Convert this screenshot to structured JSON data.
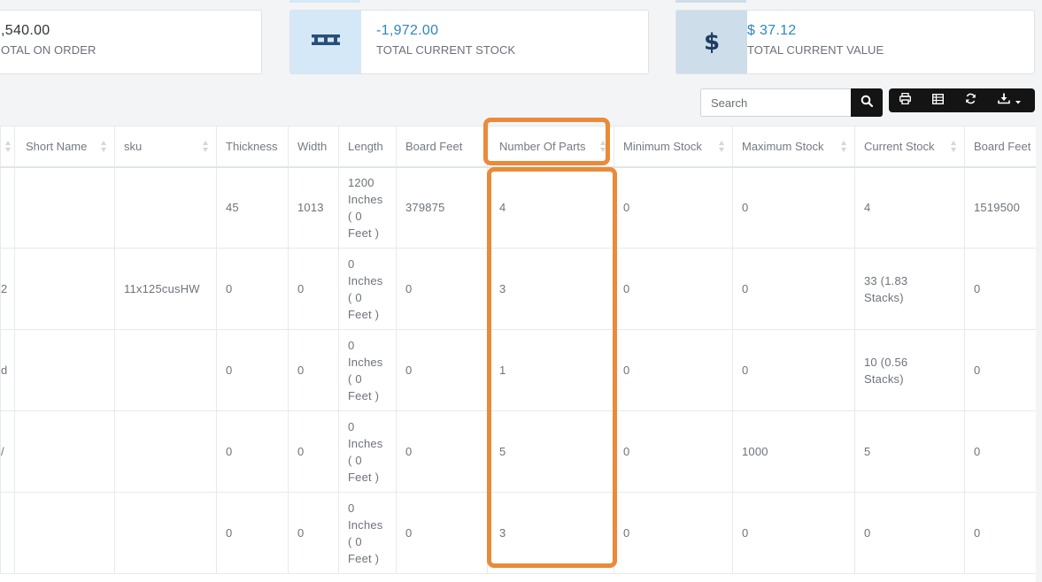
{
  "stats": {
    "on_order": {
      "value": ",540.00",
      "label": "OTAL ON ORDER"
    },
    "current_stock": {
      "value": "-1,972.00",
      "label": "TOTAL CURRENT STOCK",
      "icon": "pallet-icon"
    },
    "current_value": {
      "value": "$ 37.12",
      "label": "TOTAL CURRENT VALUE",
      "icon": "dollar-icon",
      "icon_glyph": "$"
    }
  },
  "colors": {
    "accent_blue": "#2e86c1",
    "icon_bg_blue": "#d4e8f7",
    "icon_bg_gray": "#cddde9",
    "highlight": "#ea8a3a",
    "toolbar_dark": "#141414"
  },
  "toolbar": {
    "search_placeholder": "Search",
    "buttons": [
      "search-icon",
      "print-icon",
      "columns-icon",
      "refresh-icon",
      "download-icon"
    ]
  },
  "table": {
    "headers": [
      "",
      "Short Name",
      "sku",
      "Thickness",
      "Width",
      "Length",
      "Board Feet",
      "Number Of Parts",
      "Minimum Stock",
      "Maximum Stock",
      "Current Stock",
      "Board Feet"
    ],
    "rows": [
      {
        "first": "",
        "short_name": "",
        "sku": "",
        "thickness": "45",
        "width": "1013",
        "length": [
          "1200",
          "Inches",
          "( 0",
          "Feet )"
        ],
        "board_feet": "379875",
        "parts": "4",
        "min": "0",
        "max": "0",
        "current": "4",
        "board_feet2": "1519500"
      },
      {
        "first": "2",
        "short_name": "",
        "sku": "11x125cusHW",
        "thickness": "0",
        "width": "0",
        "length": [
          "0",
          "Inches",
          "( 0",
          "Feet )"
        ],
        "board_feet": "0",
        "parts": "3",
        "min": "0",
        "max": "0",
        "current": "33 (1.83 Stacks)",
        "board_feet2": "0"
      },
      {
        "first": "d",
        "short_name": "",
        "sku": "",
        "thickness": "0",
        "width": "0",
        "length": [
          "0",
          "Inches",
          "( 0",
          "Feet )"
        ],
        "board_feet": "0",
        "parts": "1",
        "min": "0",
        "max": "0",
        "current": "10 (0.56 Stacks)",
        "board_feet2": "0"
      },
      {
        "first": "/",
        "short_name": "",
        "sku": "",
        "thickness": "0",
        "width": "0",
        "length": [
          "0",
          "Inches",
          "( 0",
          "Feet )"
        ],
        "board_feet": "0",
        "parts": "5",
        "min": "0",
        "max": "1000",
        "current": "5",
        "board_feet2": "0"
      },
      {
        "first": "",
        "short_name": "",
        "sku": "",
        "thickness": "0",
        "width": "0",
        "length": [
          "0",
          "Inches",
          "( 0",
          "Feet )"
        ],
        "board_feet": "0",
        "parts": "3",
        "min": "0",
        "max": "0",
        "current": "0",
        "board_feet2": "0"
      }
    ]
  }
}
